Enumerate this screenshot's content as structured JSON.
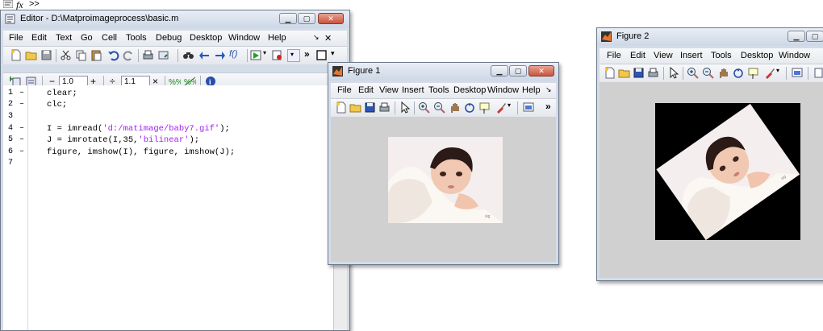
{
  "command_window": {
    "prompt": ">>",
    "fx_label": "fx"
  },
  "editor": {
    "title": "Editor - D:\\Matproimageprocess\\basic.m",
    "menus": [
      "File",
      "Edit",
      "Text",
      "Go",
      "Cell",
      "Tools",
      "Debug",
      "Desktop",
      "Window",
      "Help"
    ],
    "cell_toolbar": {
      "minus": "−",
      "value1": "1.0",
      "plus": "+",
      "divide": "÷",
      "value2": "1.1",
      "times": "×"
    },
    "line_numbers": [
      "1",
      "2",
      "3",
      "4",
      "5",
      "6",
      "7"
    ],
    "line_markers": [
      "–",
      "–",
      "",
      "–",
      "–",
      "–",
      ""
    ],
    "code": {
      "l1": "clear;",
      "l2": "clc;",
      "l4a": "I = imread(",
      "l4s": "'d:/matimage/baby7.gif'",
      "l4b": ");",
      "l5a": "J = imrotate(I,35,",
      "l5s": "'bilinear'",
      "l5b": ");",
      "l6": "figure, imshow(I), figure, imshow(J);"
    }
  },
  "figure1": {
    "title": "Figure 1",
    "menus": [
      "File",
      "Edit",
      "View",
      "Insert",
      "Tools",
      "Desktop",
      "Window",
      "Help"
    ]
  },
  "figure2": {
    "title": "Figure 2",
    "menus": [
      "File",
      "Edit",
      "View",
      "Insert",
      "Tools",
      "Desktop",
      "Window"
    ]
  },
  "colors": {
    "string": "#a020f0",
    "figure_bg": "#d0d0d0",
    "title_bar": "#d4dce8"
  },
  "icons": [
    "new-file-icon",
    "open-folder-icon",
    "save-icon",
    "print-icon",
    "arrow-pointer-icon",
    "zoom-in-icon",
    "zoom-out-icon",
    "pan-hand-icon",
    "rotate-3d-icon",
    "data-cursor-icon",
    "brush-icon",
    "colorbar-icon",
    "run-icon",
    "find-icon"
  ]
}
